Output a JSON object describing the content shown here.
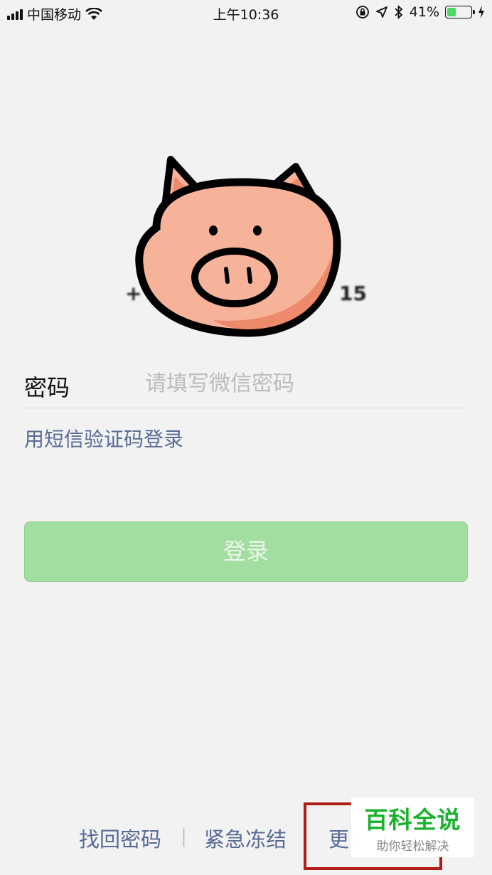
{
  "status_bar": {
    "carrier": "中国移动",
    "time": "上午10:36",
    "battery_percent": "41%",
    "battery_level": 0.41,
    "icons": [
      "signal-icon",
      "wifi-icon",
      "orientation-lock-icon",
      "location-icon",
      "bluetooth-icon",
      "battery-icon",
      "charging-icon"
    ]
  },
  "profile": {
    "avatar_icon": "pig-avatar-icon",
    "phone_prefix": "+",
    "phone_suffix": "15"
  },
  "login_form": {
    "password_label": "密码",
    "password_placeholder": "请填写微信密码",
    "password_value": "",
    "sms_login_link": "用短信验证码登录",
    "login_button": "登录"
  },
  "footer": {
    "recover_password": "找回密码",
    "separator": "|",
    "emergency_freeze": "紧急冻结",
    "more": "更"
  },
  "watermark": {
    "title": "百科全说",
    "subtitle": "助你轻松解决"
  },
  "colors": {
    "background": "#f2f2f2",
    "link": "#586b94",
    "login_button_bg": "#a3dea1",
    "highlight_border": "#b01d17",
    "watermark_green": "#19b22c",
    "avatar_fill": "#f7b39a"
  }
}
